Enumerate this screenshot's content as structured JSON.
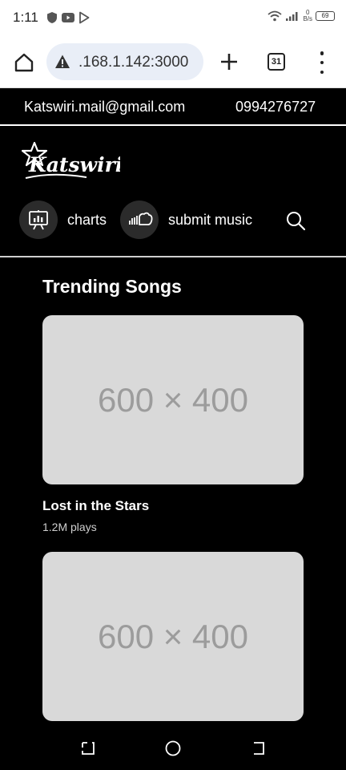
{
  "status_bar": {
    "time": "1:11",
    "net_speed_value": "0",
    "net_speed_unit": "B/s",
    "battery_level": "69"
  },
  "browser": {
    "url": ".168.1.142:3000",
    "tab_count": "31"
  },
  "contact": {
    "email": "Katswiri.mail@gmail.com",
    "phone": "0994276727"
  },
  "logo": {
    "text": "Katswiri"
  },
  "nav": {
    "charts_label": "charts",
    "submit_label": "submit music"
  },
  "main": {
    "section_title": "Trending Songs",
    "songs": [
      {
        "placeholder": "600 × 400",
        "title": "Lost in the Stars",
        "plays": "1.2M plays"
      },
      {
        "placeholder": "600 × 400"
      }
    ]
  },
  "colors": {
    "page_background": "#000000",
    "card_placeholder": "#d9d9d9",
    "url_pill": "#e9eef7"
  }
}
